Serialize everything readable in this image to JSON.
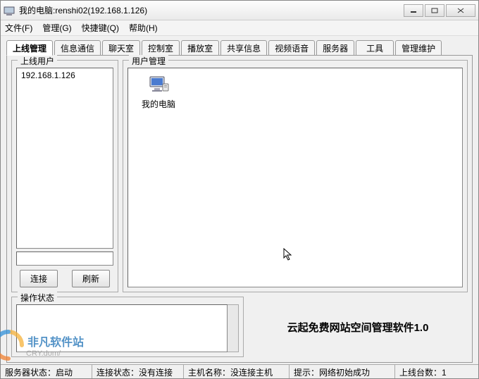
{
  "title": "我的电脑:renshi02(192.168.1.126)",
  "menu": {
    "file": "文件(F)",
    "manage": "管理(G)",
    "shortcut": "快捷键(Q)",
    "help": "帮助(H)"
  },
  "tabs": [
    "上线管理",
    "信息通信",
    "聊天室",
    "控制室",
    "播放室",
    "共享信息",
    "视频语音",
    "服务器",
    "工具",
    "管理维护"
  ],
  "online": {
    "legend": "上线用户",
    "items": [
      "192.168.1.126"
    ],
    "connect": "连接",
    "refresh": "刷新"
  },
  "usermgmt": {
    "legend": "用户管理",
    "icon_label": "我的电脑"
  },
  "opstatus": {
    "legend": "操作状态"
  },
  "brand": "云起免费网站空间管理软件1.0",
  "status": {
    "s1": "服务器状态：启动",
    "s2": "连接状态：没有连接",
    "s3": "主机名称：没连接主机",
    "s4": "提示：网络初始成功",
    "s5": "上线台数：1"
  },
  "watermark": {
    "name": "非凡软件站",
    "sub": "CRY.dom/"
  }
}
